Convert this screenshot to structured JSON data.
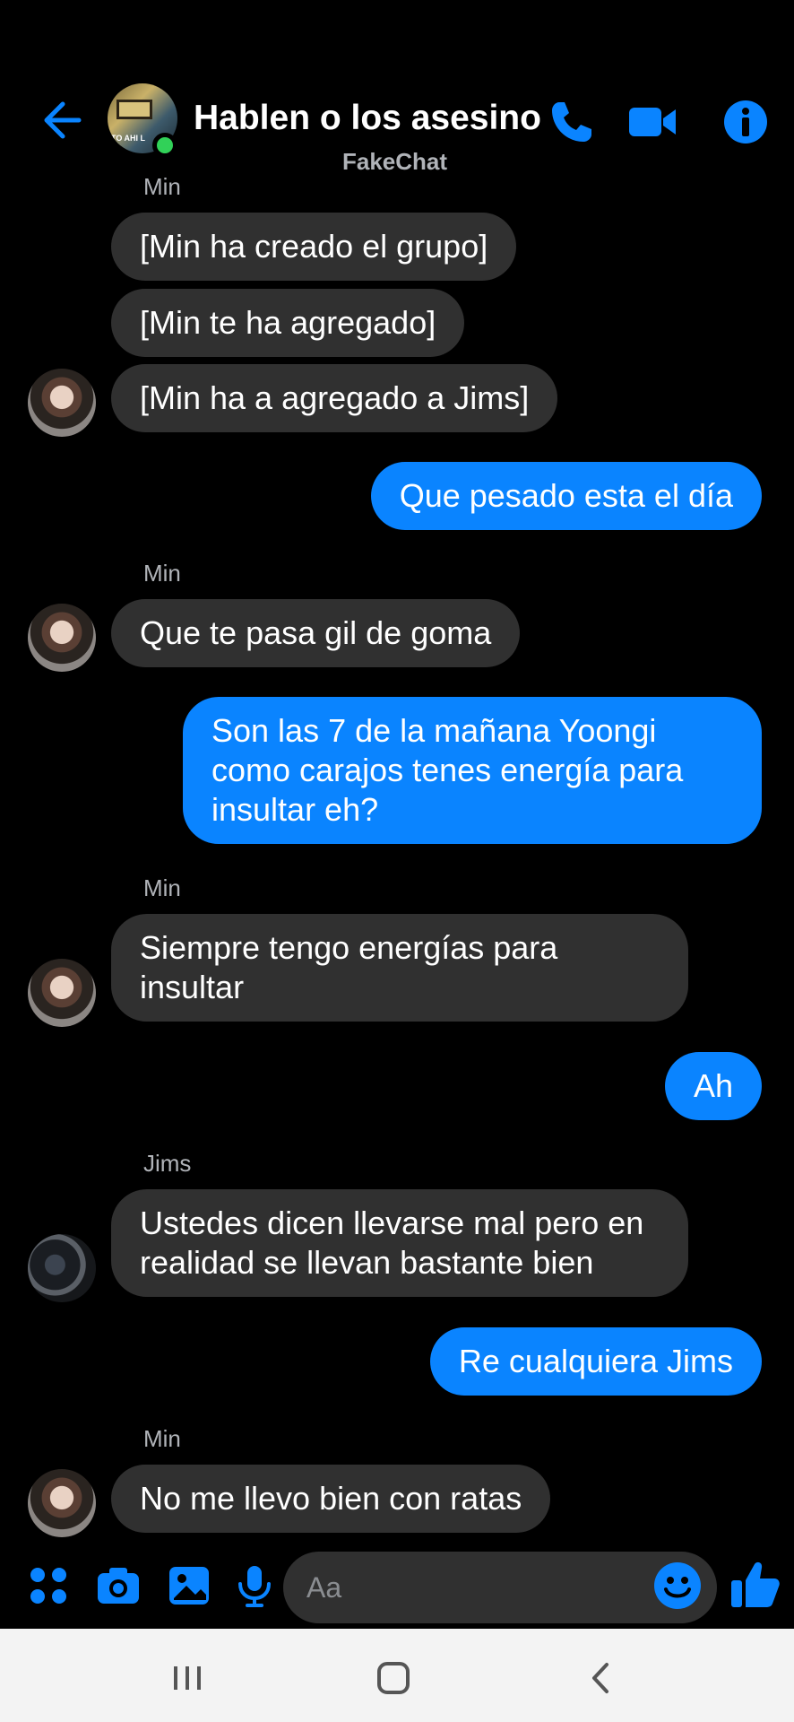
{
  "header": {
    "title": "Hablen o los asesino",
    "subtitle": "FakeChat",
    "avatar_text": "TO AHI L",
    "icons": [
      "back-arrow-icon",
      "phone-icon",
      "video-camera-icon",
      "info-icon"
    ]
  },
  "colors": {
    "accent": "#0a84ff",
    "incoming_bubble": "#303030",
    "background": "#000000",
    "online": "#31d158"
  },
  "messages": [
    {
      "sender": "Min",
      "text": "[Min ha creado el grupo]",
      "dir": "in"
    },
    {
      "text": "[Min te ha agregado]",
      "dir": "in"
    },
    {
      "text": "[Min ha a agregado a Jims]",
      "dir": "in"
    },
    {
      "text": "Que pesado esta el día",
      "dir": "out"
    },
    {
      "sender": "Min",
      "text": "Que te pasa gil de goma",
      "dir": "in"
    },
    {
      "text": "Son las 7 de la mañana Yoongi como carajos tenes energía para insultar eh?",
      "dir": "out"
    },
    {
      "sender": "Min",
      "text": "Siempre tengo energías para insultar",
      "dir": "in"
    },
    {
      "text": "Ah",
      "dir": "out"
    },
    {
      "sender": "Jims",
      "text": "Ustedes dicen llevarse mal pero en realidad se llevan bastante bien",
      "dir": "in"
    },
    {
      "text": "Re cualquiera Jims",
      "dir": "out"
    },
    {
      "sender": "Min",
      "text": "No me llevo bien con ratas",
      "dir": "in"
    }
  ],
  "composer": {
    "placeholder": "Aa",
    "icons": [
      "apps-icon",
      "camera-icon",
      "gallery-icon",
      "microphone-icon",
      "emoji-icon",
      "thumbs-up-icon"
    ]
  },
  "navbar": {
    "icons": [
      "recents-icon",
      "home-icon",
      "back-icon"
    ]
  }
}
